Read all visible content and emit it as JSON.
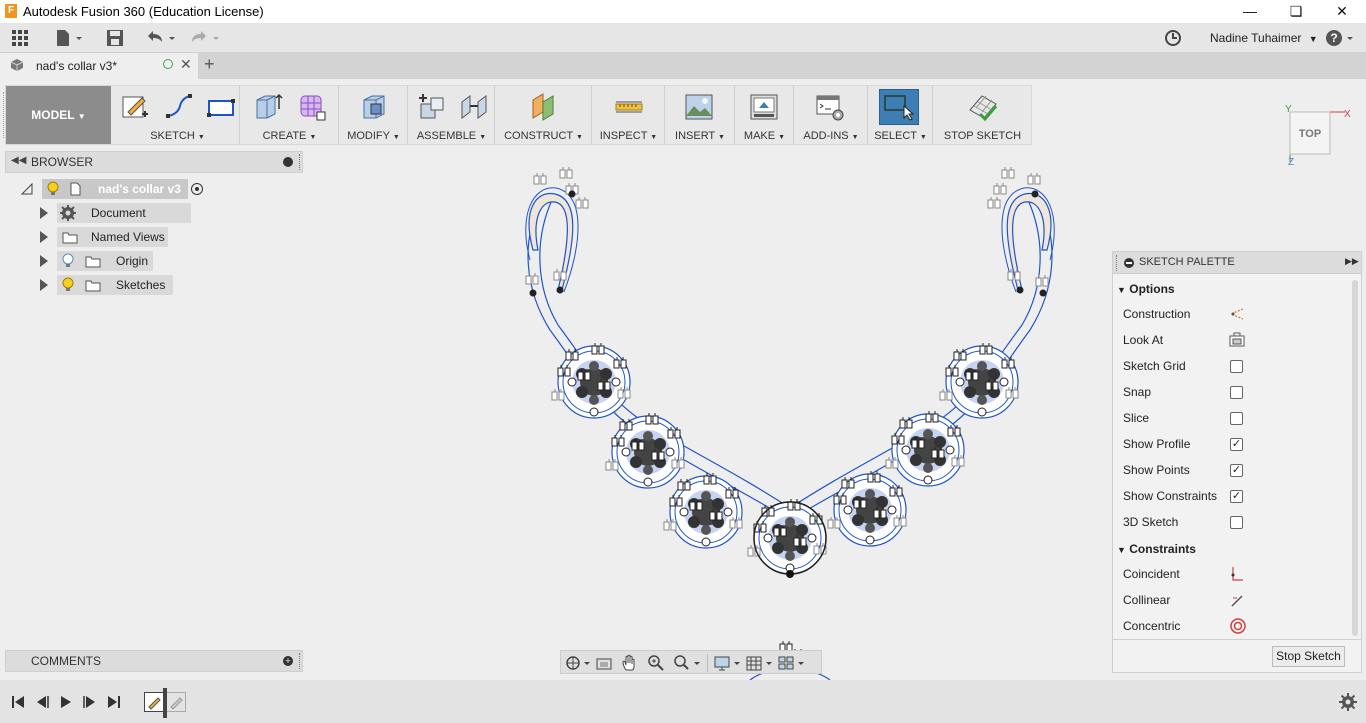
{
  "window": {
    "title": "Autodesk Fusion 360 (Education License)",
    "app_icon_letter": "F"
  },
  "user": {
    "name": "Nadine Tuhaimer"
  },
  "document_tab": {
    "name": "nad's collar v3*"
  },
  "toolbar": {
    "workspace": "MODEL",
    "groups": {
      "sketch": "SKETCH",
      "create": "CREATE",
      "modify": "MODIFY",
      "assemble": "ASSEMBLE",
      "construct": "CONSTRUCT",
      "inspect": "INSPECT",
      "insert": "INSERT",
      "make": "MAKE",
      "addins": "ADD-INS",
      "select": "SELECT",
      "stop_sketch": "STOP SKETCH"
    }
  },
  "browser": {
    "title": "BROWSER",
    "root": "nad's collar v3",
    "items": [
      "Document Settings",
      "Named Views",
      "Origin",
      "Sketches"
    ]
  },
  "comments": {
    "title": "COMMENTS"
  },
  "viewcube": {
    "face": "TOP",
    "axis_x": "X",
    "axis_y": "Y",
    "axis_z": "Z"
  },
  "sketch_palette": {
    "title": "SKETCH PALETTE",
    "options_header": "Options",
    "options": [
      {
        "label": "Construction",
        "control": "icon"
      },
      {
        "label": "Look At",
        "control": "icon"
      },
      {
        "label": "Sketch Grid",
        "checked": false
      },
      {
        "label": "Snap",
        "checked": false
      },
      {
        "label": "Slice",
        "checked": false
      },
      {
        "label": "Show Profile",
        "checked": true
      },
      {
        "label": "Show Points",
        "checked": true
      },
      {
        "label": "Show Constraints",
        "checked": true
      },
      {
        "label": "3D Sketch",
        "checked": false
      }
    ],
    "constraints_header": "Constraints",
    "constraints": [
      "Coincident",
      "Collinear",
      "Concentric"
    ],
    "stop_button": "Stop Sketch"
  },
  "colors": {
    "accent_blue": "#1f54c9",
    "select_highlight": "#3d7fb5",
    "model_button": "#8c8c8c"
  }
}
